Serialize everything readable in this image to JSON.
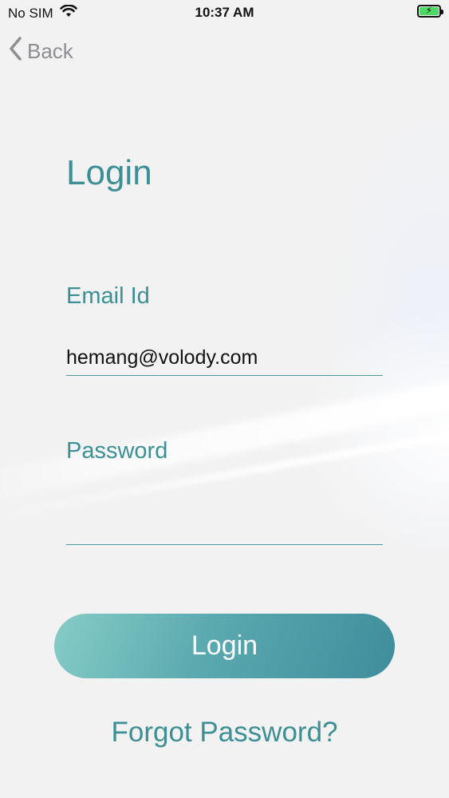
{
  "status_bar": {
    "carrier": "No SIM",
    "time": "10:37 AM",
    "battery_color": "#4cd964"
  },
  "nav": {
    "back_label": "Back",
    "back_icon": "chevron-left-icon"
  },
  "login_form": {
    "title": "Login",
    "email_label": "Email Id",
    "email_value": "hemang@volody.com",
    "password_label": "Password",
    "password_value": "",
    "submit_label": "Login",
    "forgot_label": "Forgot Password?"
  },
  "colors": {
    "accent": "#3b8f95",
    "button_gradient_start": "#86ccc6",
    "button_gradient_end": "#3f8d9c"
  }
}
